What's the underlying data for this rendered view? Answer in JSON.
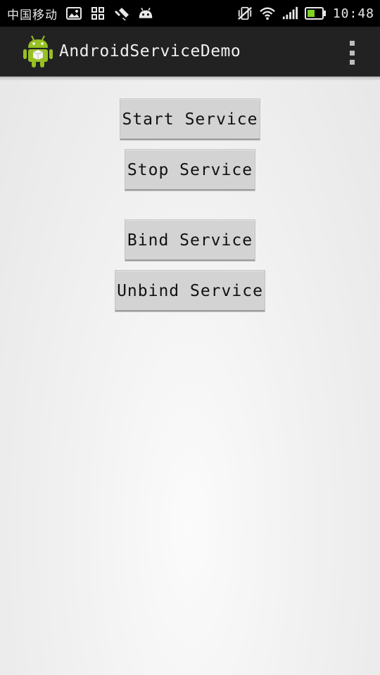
{
  "status_bar": {
    "carrier": "中国移动",
    "time": "10:48",
    "icons": [
      "gallery-icon",
      "qr-grid-icon",
      "usb-debug-icon",
      "android-notification-icon",
      "vibrate-off-icon",
      "wifi-icon",
      "signal-icon",
      "battery-icon"
    ]
  },
  "action_bar": {
    "title": "AndroidServiceDemo",
    "app_icon": "android-robot-icon",
    "menu_icon": "overflow-menu-icon"
  },
  "buttons": {
    "start": "Start Service",
    "stop": "Stop Service",
    "bind": "Bind Service",
    "unbind": "Unbind Service"
  },
  "colors": {
    "status_bar_bg": "#000000",
    "action_bar_bg": "#222222",
    "button_bg": "#d3d3d3",
    "android_green": "#97c024"
  }
}
